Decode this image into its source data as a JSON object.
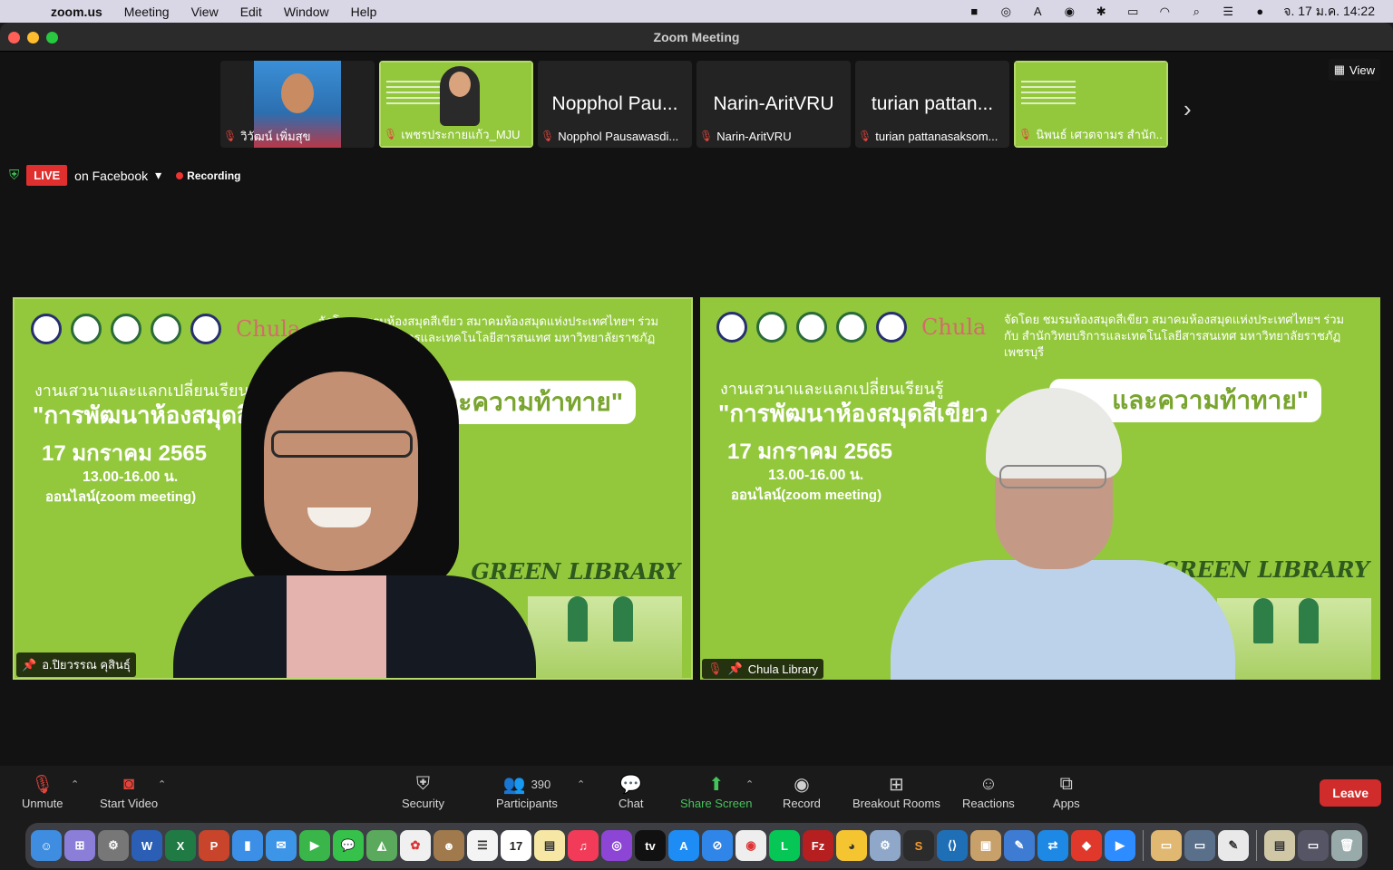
{
  "menubar": {
    "app_name": "zoom.us",
    "menus": [
      "Meeting",
      "View",
      "Edit",
      "Window",
      "Help"
    ],
    "clock": "จ. 17 ม.ค.  14:22"
  },
  "window": {
    "title": "Zoom Meeting"
  },
  "thumbnails": [
    {
      "caption": "วิวัฒน์ เพิ่มสุข",
      "big_name": "",
      "kind": "photo",
      "active": false
    },
    {
      "caption": "เพชรประกายแก้ว_MJU",
      "big_name": "",
      "kind": "slide",
      "active": true
    },
    {
      "caption": "Nopphol Pausawasdi...",
      "big_name": "Nopphol Pau...",
      "kind": "name",
      "active": false
    },
    {
      "caption": "Narin-AritVRU",
      "big_name": "Narin-AritVRU",
      "kind": "name",
      "active": false
    },
    {
      "caption": "turian pattanasaksom...",
      "big_name": "turian pattan...",
      "kind": "name",
      "active": false
    },
    {
      "caption": "นิพนธ์ เศวตจามร สำนัก...",
      "big_name": "",
      "kind": "slide",
      "active": true
    }
  ],
  "view_label": "View",
  "live": {
    "badge": "LIVE",
    "platform": "on Facebook",
    "recording": "Recording"
  },
  "slide": {
    "org_text": "จัดโดย ชมรมห้องสมุดสีเขียว สมาคมห้องสมุดแห่งประเทศไทยฯ ร่วมกับ สำนักวิทยบริการและเทคโนโลยีสารสนเทศ มหาวิทยาลัยราชภัฏเพชรบุรี",
    "seminar": "งานเสวนาและแลกเปลี่ยนเรียนรู้",
    "heading": "\"การพัฒนาห้องสมุดสีเขียว :",
    "pill": "และความท้าทาย\"",
    "date": "17 มกราคม 2565",
    "time": "13.00-16.00 น.",
    "online": "ออนไลน์(zoom meeting)",
    "brand": "Chula",
    "green_library": "GREEN LIBRARY"
  },
  "videos": [
    {
      "label": "อ.ปิยวรรณ คุสินธุ์"
    },
    {
      "label": "Chula Library"
    }
  ],
  "toolbar": {
    "unmute": "Unmute",
    "start_video": "Start Video",
    "security": "Security",
    "participants": "Participants",
    "participants_count": "390",
    "chat": "Chat",
    "share_screen": "Share Screen",
    "record": "Record",
    "breakout": "Breakout Rooms",
    "reactions": "Reactions",
    "apps": "Apps",
    "leave": "Leave"
  },
  "colors": {
    "slide_green": "#93c83d",
    "active_border": "#b4d96a",
    "live_red": "#e02f2f",
    "leave_red": "#d12c2c",
    "share_green": "#46c35b"
  }
}
